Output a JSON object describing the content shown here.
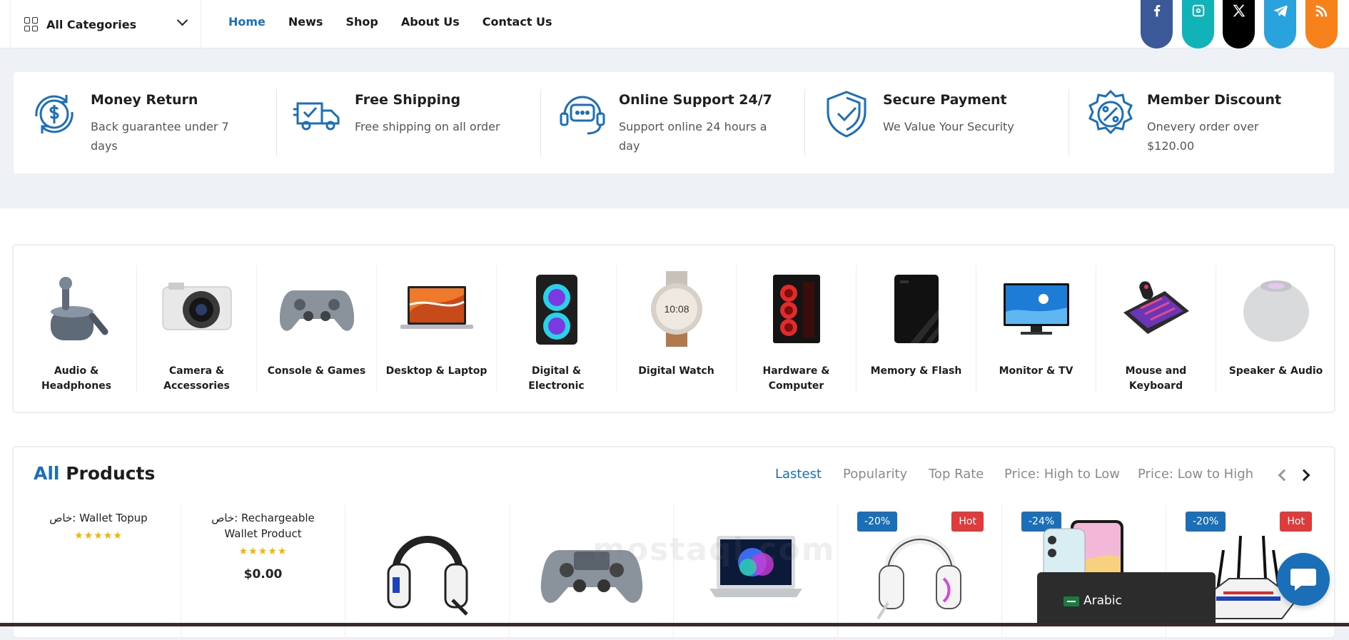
{
  "header": {
    "categories_label": "All Categories",
    "nav": [
      "Home",
      "News",
      "Shop",
      "About Us",
      "Contact Us"
    ],
    "active_nav": "Home",
    "social": [
      {
        "icon": "facebook-icon",
        "color": "#3b5998"
      },
      {
        "icon": "instagram-icon",
        "color": "#0fb3b8"
      },
      {
        "icon": "x-icon",
        "color": "#000000"
      },
      {
        "icon": "telegram-icon",
        "color": "#2aa2de"
      },
      {
        "icon": "rss-icon",
        "color": "#f7821b"
      }
    ]
  },
  "features": [
    {
      "icon": "money-return-icon",
      "title": "Money Return",
      "desc": "Back guarantee under 7 days"
    },
    {
      "icon": "truck-icon",
      "title": "Free Shipping",
      "desc": "Free shipping on all order"
    },
    {
      "icon": "support-headset-icon",
      "title": "Online Support 24/7",
      "desc": "Support online 24 hours a day"
    },
    {
      "icon": "shield-check-icon",
      "title": "Secure Payment",
      "desc": "We Value Your Security"
    },
    {
      "icon": "discount-badge-icon",
      "title": "Member Discount",
      "desc": "Onevery order over $120.00"
    }
  ],
  "categories": [
    "Audio & Headphones",
    "Camera & Accessories",
    "Console & Games",
    "Desktop & Laptop",
    "Digital & Electronic",
    "Digital Watch",
    "Hardware & Computer",
    "Memory & Flash",
    "Monitor & TV",
    "Mouse and Keyboard",
    "Speaker & Audio"
  ],
  "products_section": {
    "title_accent": "All",
    "title_rest": "Products",
    "tabs": [
      "Lastest",
      "Popularity",
      "Top Rate",
      "Price: High to Low",
      "Price: Low to High"
    ],
    "active_tab": "Lastest"
  },
  "products": [
    {
      "name": "خاص: Wallet Topup",
      "stars": "★★★★★",
      "price": ""
    },
    {
      "name": "خاص: Rechargeable Wallet Product",
      "stars": "★★★★★",
      "price": "$0.00"
    },
    {
      "name": "",
      "image": "headset-white-icon"
    },
    {
      "name": "",
      "image": "gamepad-icon"
    },
    {
      "name": "",
      "image": "laptop-icon"
    },
    {
      "name": "",
      "image": "gaming-headset-icon",
      "discount": "-20%",
      "tag": "Hot"
    },
    {
      "name": "",
      "image": "smartphone-icon",
      "discount": "-24%"
    },
    {
      "name": "",
      "image": "router-icon",
      "discount": "-20%",
      "tag": "Hot"
    }
  ],
  "language": {
    "label": "Arabic"
  },
  "watermark": "mostaql.com"
}
